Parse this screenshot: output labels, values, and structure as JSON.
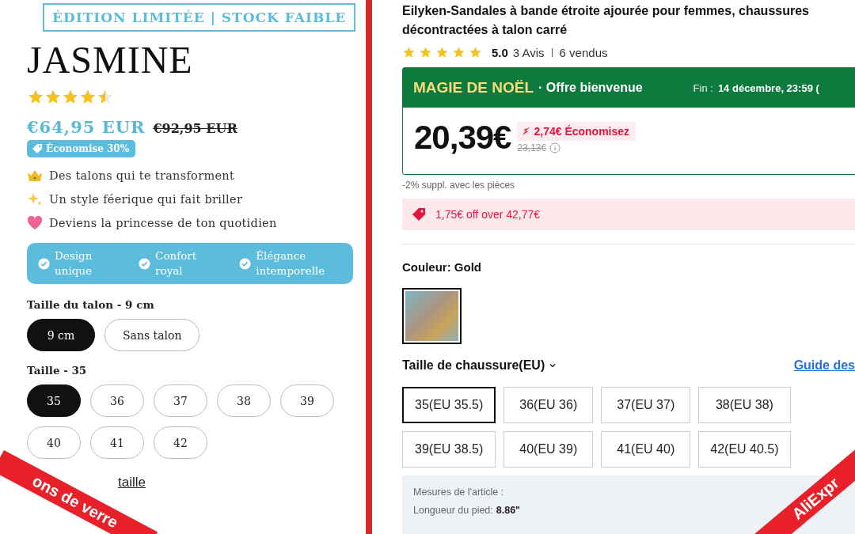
{
  "left": {
    "banner": "ÉDITION LIMITÉE | STOCK FAIBLE",
    "title": "JASMINE",
    "stars": 4.5,
    "price": "€64,95 EUR",
    "compare_price": "€92,95 EUR",
    "discount_badge": "Économise 30%",
    "benefits": [
      {
        "kind": "crown",
        "text": "Des talons qui te transforment"
      },
      {
        "kind": "sparkles",
        "text": "Un style féerique qui fait briller"
      },
      {
        "kind": "heart",
        "text": "Deviens la princesse de ton quotidien"
      }
    ],
    "features": [
      {
        "line1": "Design",
        "line2": "unique"
      },
      {
        "line1": "Confort",
        "line2": "royal"
      },
      {
        "line1": "Élégance",
        "line2": "intemporelle"
      }
    ],
    "heel": {
      "label": "Taille du talon - 9 cm",
      "options": [
        {
          "label": "9 cm",
          "selected": true
        },
        {
          "label": "Sans talon",
          "selected": false
        }
      ]
    },
    "size": {
      "label": "Taille - 35",
      "options": [
        {
          "label": "35",
          "selected": true
        },
        {
          "label": "36",
          "selected": false
        },
        {
          "label": "37",
          "selected": false
        },
        {
          "label": "38",
          "selected": false
        },
        {
          "label": "39",
          "selected": false
        },
        {
          "label": "40",
          "selected": false
        },
        {
          "label": "41",
          "selected": false
        },
        {
          "label": "42",
          "selected": false
        }
      ]
    },
    "size_guide_link": "taille"
  },
  "right": {
    "title": "Eilyken-Sandales à bande étroite ajourée pour femmes, chaussures décontractées à talon carré",
    "stars": 5,
    "rating": "5.0",
    "reviews": "3 Avis",
    "sold": "6 vendus",
    "promo": {
      "brand": "MAGIE DE NOËL",
      "offer": "· Offre bienvenue",
      "end_label": "Fin :",
      "end_date": "14 décembre, 23:59 (",
      "price": "20,39€",
      "savings": "2,74€ Économisez",
      "old_price": "23,13€"
    },
    "coins_note": "-2% suppl. avec les pièces",
    "coupon": "1,75€ off over 42,77€",
    "color_label": "Couleur: Gold",
    "swatches": [
      {
        "selected": true
      }
    ],
    "size_label": "Taille de chaussure(EU)",
    "size_guide_link": "Guide des",
    "sizes": [
      {
        "label": "35(EU 35.5)",
        "selected": true
      },
      {
        "label": "36(EU 36)",
        "selected": false
      },
      {
        "label": "37(EU 37)",
        "selected": false
      },
      {
        "label": "38(EU 38)",
        "selected": false
      },
      {
        "label": "39(EU 38.5)",
        "selected": false
      },
      {
        "label": "40(EU 39)",
        "selected": false
      },
      {
        "label": "41(EU 40)",
        "selected": false
      },
      {
        "label": "42(EU 40.5)",
        "selected": false
      }
    ],
    "measures": {
      "title": "Mesures de l'article :",
      "label": "Longueur du pied:",
      "value": "8.86\""
    }
  },
  "ribbons": [
    {
      "kind": "left",
      "text": "ons de verre"
    },
    {
      "kind": "right",
      "text": "AliExpr"
    }
  ]
}
